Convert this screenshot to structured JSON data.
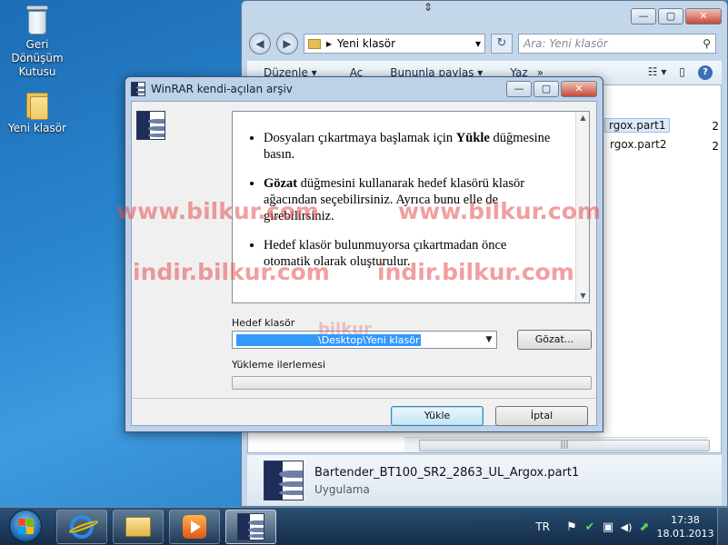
{
  "desktop": {
    "icons": [
      {
        "label": "Geri Dönüşüm Kutusu"
      },
      {
        "label": "Yeni klasör"
      }
    ]
  },
  "explorer": {
    "controls": {
      "min": "—",
      "max": "▢",
      "close": "✕"
    },
    "nav": {
      "back": "◀",
      "forward": "▶"
    },
    "address": "Yeni klasör",
    "address_arrow": "▸",
    "address_dropdown": "▾",
    "refresh": "↻",
    "search_placeholder": "Ara: Yeni klasör",
    "search_icon": "⚲",
    "toolbar": {
      "organize": "Düzenle ▾",
      "open": "Aç",
      "share": "Bununla paylaş ▾",
      "burn": "Yaz",
      "more": "»",
      "views": "☷ ▾",
      "pane": "▯",
      "help": "?"
    },
    "files": [
      {
        "name": "rgox.part1",
        "size": "2"
      },
      {
        "name": "rgox.part2",
        "size": "2"
      }
    ],
    "details": {
      "filename": "Bartender_BT100_SR2_2863_UL_Argox.part1",
      "type": "Uygulama"
    },
    "hscroll_grip": "|||"
  },
  "dialog": {
    "title": "WinRAR kendi-açılan arşiv",
    "controls": {
      "min": "—",
      "max": "▢",
      "close": "✕"
    },
    "info": [
      {
        "bold": "",
        "pre": "Dosyaları çıkartmaya başlamak için ",
        "b": "Yükle",
        "post": " düğmesine basın."
      },
      {
        "pre": "",
        "b": "Gözat",
        "post": " düğmesini kullanarak hedef klasörü klasör ağacından seçebilirsiniz. Ayrıca bunu elle de girebilirsiniz."
      },
      {
        "pre": "Hedef klasör bulunmuyorsa çıkartmadan önce otomatik olarak oluşturulur.",
        "b": "",
        "post": ""
      }
    ],
    "dest_label": "Hedef klasör",
    "dest_value": "\\Desktop\\Yeni klasör",
    "browse_button": "Gözat...",
    "progress_label": "Yükleme ilerlemesi",
    "progress": 0,
    "install_button": "Yükle",
    "cancel_button": "İptal",
    "scroll_up": "▲",
    "scroll_down": "▼",
    "combo_arrow": "▼"
  },
  "watermarks": {
    "w1": "www.bilkur.com",
    "w2": "www.bilkur.com",
    "w3": "indir.bilkur.com",
    "w4": "indir.bilkur.com",
    "w5": "bilkur"
  },
  "taskbar": {
    "language": "TR",
    "time": "17:38",
    "date": "18.01.2013",
    "tray_icons": [
      "⚑",
      "✔",
      "▣",
      "◀)",
      "⬈"
    ]
  }
}
